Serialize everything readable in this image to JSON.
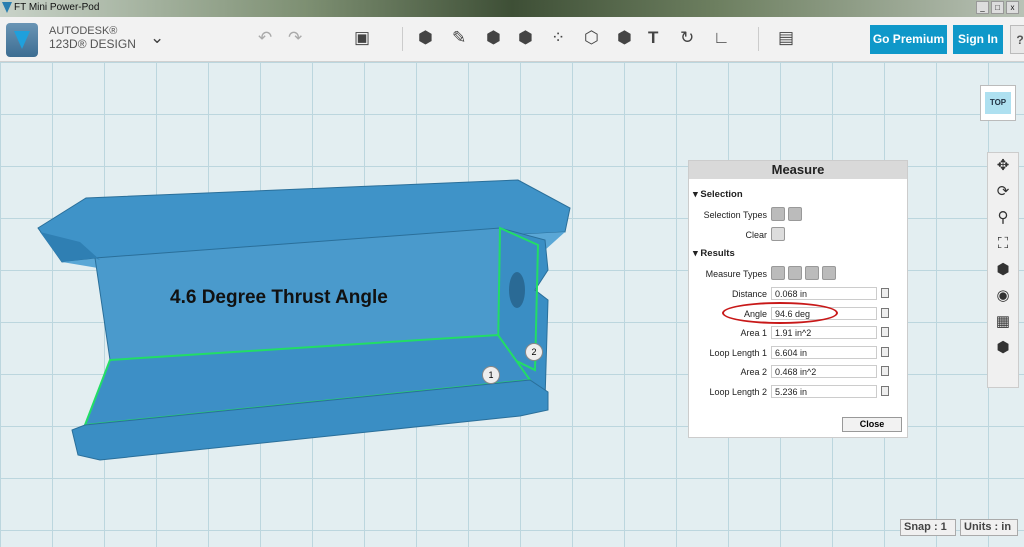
{
  "window": {
    "title": "FT Mini Power-Pod",
    "min": "_",
    "max": "□",
    "close": "x"
  },
  "app": {
    "brand_line1": "AUTODESK®",
    "brand_line2": "123D® DESIGN",
    "menu": "⌄",
    "undo": "↶",
    "redo": "↷"
  },
  "toolbar": {
    "tools": [
      "primitives",
      "sketch",
      "construct",
      "modify",
      "pattern",
      "grouping",
      "combine",
      "text",
      "snap",
      "measure",
      "material"
    ],
    "go_premium": "Go Premium",
    "sign_in": "Sign In",
    "help": "?"
  },
  "viewcube": {
    "face": "TOP"
  },
  "navbar": {
    "items": [
      "pan-icon",
      "orbit-icon",
      "zoom-icon",
      "fit-icon",
      "view-icon",
      "visibility-icon",
      "materials-icon",
      "grid-icon"
    ]
  },
  "annotation": {
    "caption": "4.6 Degree Thrust Angle",
    "marker1": "1",
    "marker2": "2"
  },
  "measure": {
    "title": "Measure",
    "selection_header": "Selection",
    "selection_types_label": "Selection Types",
    "clear_label": "Clear",
    "results_header": "Results",
    "measure_types_label": "Measure Types",
    "results": [
      {
        "label": "Distance",
        "value": "0.068 in"
      },
      {
        "label": "Angle",
        "value": "94.6 deg"
      },
      {
        "label": "Area 1",
        "value": "1.91 in^2"
      },
      {
        "label": "Loop Length 1",
        "value": "6.604 in"
      },
      {
        "label": "Area 2",
        "value": "0.468 in^2"
      },
      {
        "label": "Loop Length 2",
        "value": "5.236 in"
      }
    ],
    "close": "Close",
    "highlight_color": "#c81818"
  },
  "status": {
    "snap": "Snap : 1",
    "units": "Units : in"
  }
}
